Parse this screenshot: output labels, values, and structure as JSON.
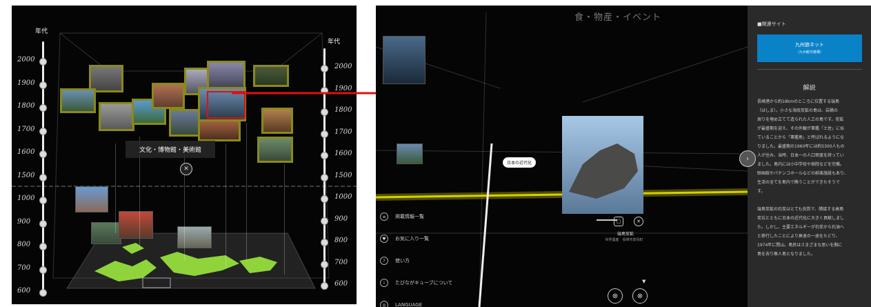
{
  "left": {
    "axis_title_left": "年代",
    "axis_title_right": "年代",
    "years_left": [
      "2000",
      "1900",
      "1800",
      "1700",
      "1600",
      "1500",
      "1000",
      "900",
      "800",
      "700",
      "600"
    ],
    "years_right": [
      "2000",
      "1900",
      "1800",
      "1700",
      "1600",
      "1500",
      "1000",
      "900",
      "800",
      "700",
      "600"
    ],
    "tooltip_label": "文化・博物館・美術館"
  },
  "right": {
    "category_title": "食・物産・イベント",
    "pin_label": "日本の近代化",
    "menu": [
      {
        "icon": "list-icon",
        "label": "掲載情報一覧"
      },
      {
        "icon": "heart-icon",
        "label": "お気に入り一覧"
      },
      {
        "icon": "help-icon",
        "label": "使い方"
      },
      {
        "icon": "info-icon",
        "label": "たびながキューブについて"
      },
      {
        "icon": "globe-icon",
        "label": "LANGUAGE"
      }
    ],
    "photo_caption_title": "端島炭鉱",
    "photo_caption_sub": "世界遺産　長崎市高島町",
    "sidebar": {
      "related_heading": "■関連サイト",
      "related_button": "九州旅ネット",
      "related_button_sub": "（九州観光機構）",
      "explanation_heading": "解説",
      "explanation_lines": [
        "長崎港から約18kmのところに位置する端島",
        "（はしま）。小さな海底炭鉱の島は、岩礁の",
        "周りを埋め立てて造られた人工の島です。炭鉱",
        "が最盛期を迎え、その外観が軍艦「土佐」に似",
        "ていることから「軍艦島」と呼ばれるようにな",
        "りました。最盛期の1960年には約5300人もの",
        "人が住み、当時、日本一の人口密度を誇ってい",
        "ました。島内には小中学校や病院などを完備。",
        "映画館やパチンコホールなどの娯楽施設もあり、",
        "生活の全てを島内で賄うことができたそうで",
        "す。",
        "",
        "端島炭鉱の石炭はとても良質で、隣接する高島",
        "炭坑とともに日本の近代化に大きく貢献しまし",
        "た。しかし、主要エネルギーが石炭から石油へ",
        "と移行したことにより衰退の一途をたどり、",
        "1974年に閉山。島民はさまざまな思いを胸に",
        "島を去り無人島となりました。"
      ]
    }
  },
  "colors": {
    "accent_yellow": "#d6d100",
    "button_blue": "#0a82c8",
    "arrow_red": "#e01010"
  }
}
